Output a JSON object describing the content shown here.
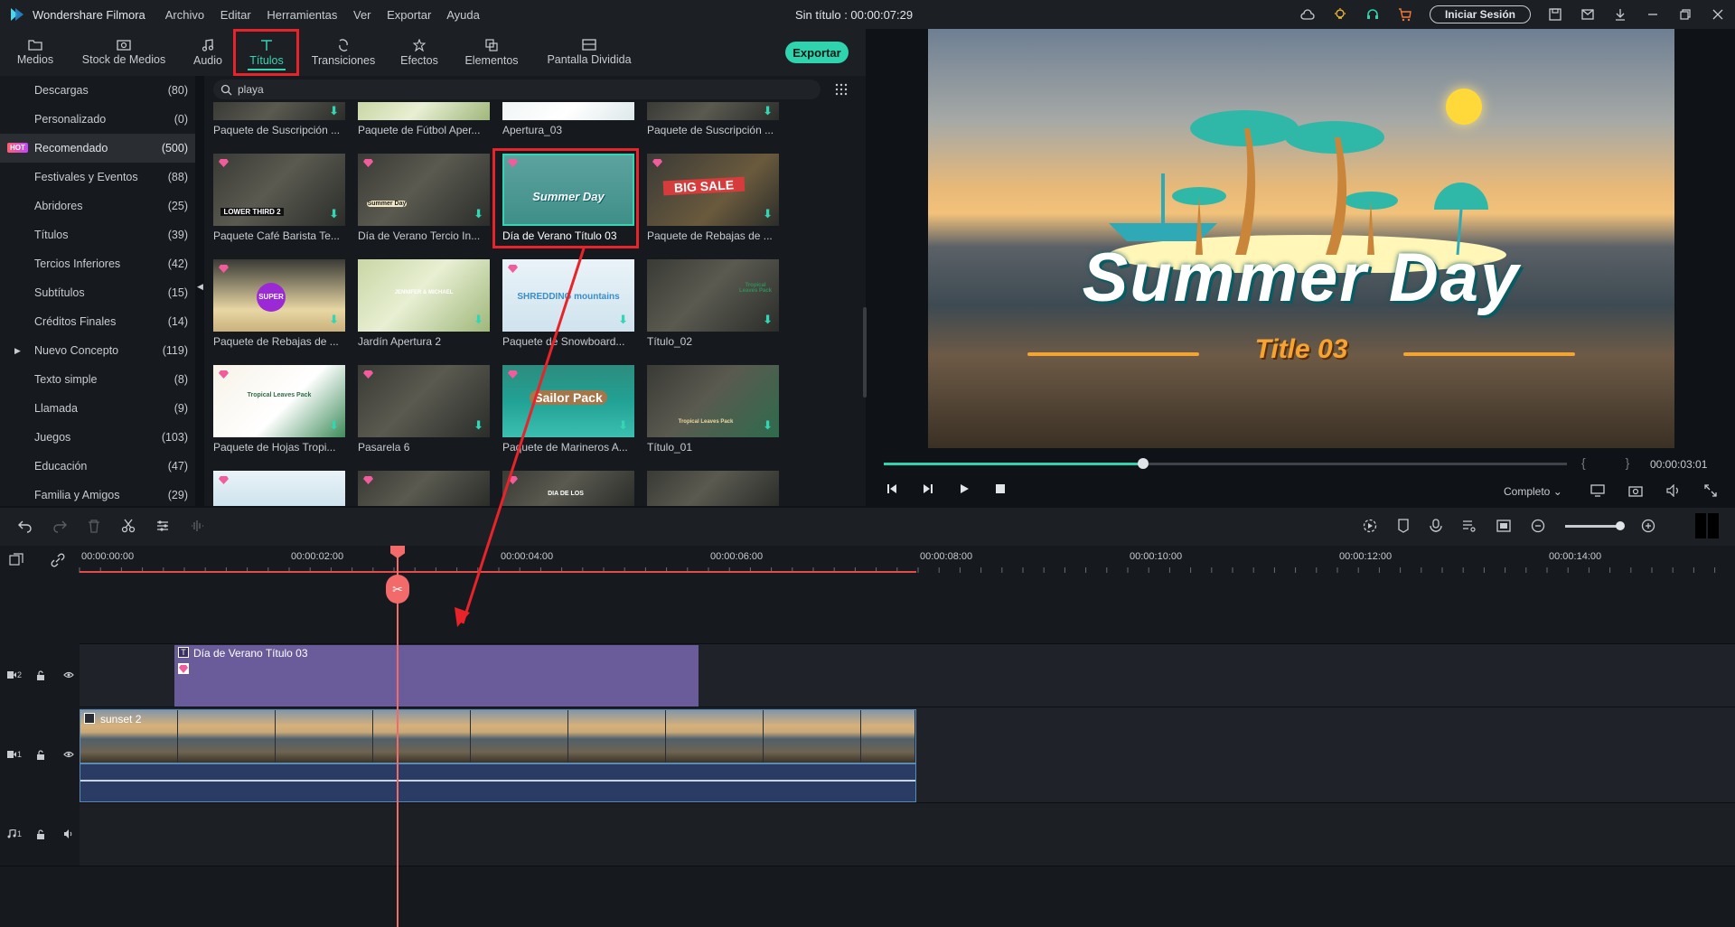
{
  "app": {
    "name": "Wondershare Filmora",
    "menu": [
      "Archivo",
      "Editar",
      "Herramientas",
      "Ver",
      "Exportar",
      "Ayuda"
    ],
    "doc_title": "Sin título : 00:00:07:29",
    "login_label": "Iniciar Sesión"
  },
  "tabs": [
    {
      "label": "Medios",
      "icon": "folder-icon"
    },
    {
      "label": "Stock de Medios",
      "icon": "stock-media-icon"
    },
    {
      "label": "Audio",
      "icon": "music-note-icon"
    },
    {
      "label": "Títulos",
      "icon": "text-t-icon",
      "active": true
    },
    {
      "label": "Transiciones",
      "icon": "transition-icon"
    },
    {
      "label": "Efectos",
      "icon": "effects-icon"
    },
    {
      "label": "Elementos",
      "icon": "elements-icon"
    },
    {
      "label": "Pantalla Dividida",
      "icon": "split-screen-icon"
    }
  ],
  "export_label": "Exportar",
  "sidebar": {
    "hot_badge": "HOT",
    "items": [
      {
        "label": "Descargas",
        "count": "(80)"
      },
      {
        "label": "Personalizado",
        "count": "(0)"
      },
      {
        "label": "Recomendado",
        "count": "(500)",
        "active": true,
        "hot": true
      },
      {
        "label": "Festivales y Eventos",
        "count": "(88)"
      },
      {
        "label": "Abridores",
        "count": "(25)"
      },
      {
        "label": "Títulos",
        "count": "(39)"
      },
      {
        "label": "Tercios Inferiores",
        "count": "(42)"
      },
      {
        "label": "Subtítulos",
        "count": "(15)"
      },
      {
        "label": "Créditos Finales",
        "count": "(14)"
      },
      {
        "label": "Nuevo Concepto",
        "count": "(119)",
        "expandable": true
      },
      {
        "label": "Texto simple",
        "count": "(8)"
      },
      {
        "label": "Llamada",
        "count": "(9)"
      },
      {
        "label": "Juegos",
        "count": "(103)"
      },
      {
        "label": "Educación",
        "count": "(47)"
      },
      {
        "label": "Familia y Amigos",
        "count": "(29)"
      }
    ]
  },
  "search": {
    "value": "playa"
  },
  "library": {
    "rows": [
      [
        "Paquete de Suscripción ...",
        "Paquete de Fútbol Aper...",
        "Apertura_03",
        "Paquete de Suscripción ..."
      ],
      [
        "Paquete Café Barista Te...",
        "Día de Verano Tercio In...",
        "Día de Verano Título 03",
        "Paquete de Rebajas de ..."
      ],
      [
        "Paquete de Rebajas de ...",
        "Jardín Apertura 2",
        "Paquete de Snowboard...",
        "Título_02"
      ],
      [
        "Paquete de Hojas Tropi...",
        "Pasarela 6",
        "Paquete de Marineros A...",
        "Título_01"
      ],
      [
        "",
        "",
        "",
        ""
      ]
    ],
    "thumb_texts": {
      "lower_third": "LOWER THIRD 2",
      "summer_small": "Summer Day",
      "big_sale": "BIG SALE",
      "super": "SUPER",
      "garden": "JENNIFER & MICHAEL",
      "shred": "SHREDDING mountains",
      "tropical": "Tropical Leaves Pack",
      "sailor": "Sailor Pack",
      "dia": "DIA DE LOS"
    },
    "selected": "Día de Verano Título 03"
  },
  "preview": {
    "title": "Summer Day",
    "subtitle": "Title 03",
    "time": "00:00:03:01",
    "progress_fraction": 0.38,
    "quality": "Completo"
  },
  "timeline": {
    "ruler": [
      "00:00:00:00",
      "00:00:02:00",
      "00:00:04:00",
      "00:00:06:00",
      "00:00:08:00",
      "00:00:10:00",
      "00:00:12:00",
      "00:00:14:00"
    ],
    "tracks": [
      {
        "label": "2",
        "type": "video"
      },
      {
        "label": "1",
        "type": "video"
      },
      {
        "label": "1",
        "type": "audio"
      }
    ],
    "title_clip": "Día de Verano Título 03",
    "video_clip": "sunset 2"
  },
  "colors": {
    "accent": "#2fd3ae",
    "annotation_red": "#e8232a",
    "playhead": "#f26a6a",
    "title_clip": "#6a5c9a"
  }
}
